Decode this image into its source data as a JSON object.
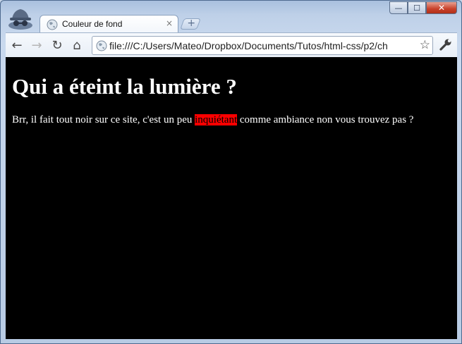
{
  "browser": {
    "tab": {
      "title": "Couleur de fond",
      "close": "×"
    },
    "new_tab": "+",
    "window_controls": {
      "minimize": "—",
      "maximize": "☐",
      "close": "✕"
    },
    "toolbar": {
      "back": "←",
      "forward": "→",
      "reload": "↻",
      "home": "⌂",
      "url": "file:///C:/Users/Mateo/Dropbox/Documents/Tutos/html-css/p2/ch",
      "bookmark": "☆"
    }
  },
  "page": {
    "heading": "Qui a éteint la lumière ?",
    "text_before": "Brr, il fait tout noir sur ce site, c'est un peu ",
    "highlight": "inquiétant",
    "text_after": " comme ambiance non vous trouvez pas ?"
  },
  "colors": {
    "page_background": "#000000",
    "text": "#ffffff",
    "highlight_background": "#ff0000",
    "highlight_text": "#000000"
  }
}
